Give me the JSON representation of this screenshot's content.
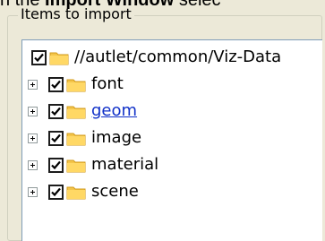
{
  "window_header_text": "n the Import Window selec",
  "window_header_bold": "Import Window",
  "group": {
    "title": "Items to import"
  },
  "tree": {
    "root": {
      "label": "//autlet/common/Viz-Data",
      "checked": true
    },
    "children": [
      {
        "label": "font",
        "checked": true,
        "expandable": true,
        "hyperlink": false
      },
      {
        "label": "geom",
        "checked": true,
        "expandable": true,
        "hyperlink": true
      },
      {
        "label": "image",
        "checked": true,
        "expandable": true,
        "hyperlink": false
      },
      {
        "label": "material",
        "checked": true,
        "expandable": true,
        "hyperlink": false
      },
      {
        "label": "scene",
        "checked": true,
        "expandable": true,
        "hyperlink": false
      }
    ]
  },
  "colors": {
    "panel_bg": "#ece9d8",
    "tree_bg": "#ffffff",
    "link": "#1030c8",
    "folder_yellow": "#f4c54a"
  }
}
